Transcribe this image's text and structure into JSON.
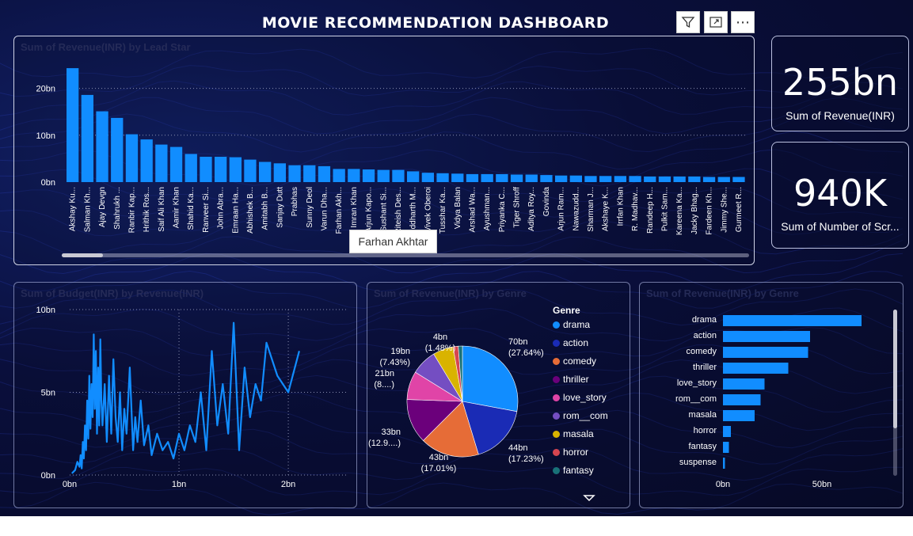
{
  "dashboard": {
    "title": "MOVIE RECOMMENDATION DASHBOARD"
  },
  "toolbar": {
    "filter_icon": "filter-icon",
    "focus_icon": "focus-mode-icon",
    "more_label": "⋯"
  },
  "tooltip": {
    "text": "Farhan Akhtar"
  },
  "cards": [
    {
      "value": "255bn",
      "label": "Sum of Revenue(INR)"
    },
    {
      "value": "940K",
      "label": "Sum of Number of Scr..."
    }
  ],
  "colors": {
    "bar": "#118dff",
    "text": "#ffffff",
    "grid": "#8a8fb0"
  },
  "chart_data": [
    {
      "type": "bar",
      "title": "Sum of Revenue(INR) by Lead Star",
      "categories": [
        "Akshay Ku...",
        "Salman Kh...",
        "Ajay Devgn",
        "Shahrukh ...",
        "Ranbir Kap...",
        "Hrithik Ros...",
        "Saif Ali Khan",
        "Aamir Khan",
        "Shahid Ka...",
        "Ranveer Si...",
        "John Abra...",
        "Emraan Ha...",
        "Abhishek B...",
        "Amitabh B...",
        "Sanjay Dutt",
        "Prabhas",
        "Sunny Deol",
        "Varun Dha...",
        "Farhan Akh...",
        "Imran Khan",
        "Arjun Kapo...",
        "Sushant Si...",
        "Riteish Des...",
        "Siddharth M...",
        "Vivek Oberoi",
        "Tusshar Ka...",
        "Vidya Balan",
        "Arshad Wa...",
        "Ayushman...",
        "Priyanka C...",
        "Tiger Shroff",
        "Aditya Roy...",
        "Govinda",
        "Arjun Ram...",
        "Nawazudd...",
        "Sharman J...",
        "Akshaye K...",
        "Irrfan Khan",
        "R. Madhav...",
        "Randeep H...",
        "Pulkit Sam...",
        "Kareena Ka...",
        "Jacky Bhag...",
        "Fardeen Kh...",
        "Jimmy She...",
        "Gurmeet R..."
      ],
      "values": [
        24.3,
        18.6,
        15.1,
        13.7,
        10.2,
        9.1,
        8.0,
        7.5,
        6.0,
        5.4,
        5.4,
        5.3,
        4.8,
        4.3,
        4.0,
        3.6,
        3.6,
        3.4,
        2.8,
        2.8,
        2.7,
        2.6,
        2.6,
        2.3,
        2.0,
        1.9,
        1.8,
        1.7,
        1.7,
        1.7,
        1.6,
        1.6,
        1.5,
        1.4,
        1.4,
        1.3,
        1.3,
        1.3,
        1.3,
        1.2,
        1.2,
        1.2,
        1.2,
        1.1,
        1.1,
        1.1
      ],
      "yticks": [
        "0bn",
        "10bn",
        "20bn"
      ],
      "ylim": [
        0,
        25
      ],
      "xlabel": "Lead Star",
      "ylabel": "Sum of Revenue(INR)",
      "grid": true
    },
    {
      "type": "line",
      "title": "Sum of Budget(INR) by Revenue(INR)",
      "x": [
        0.02,
        0.05,
        0.07,
        0.09,
        0.1,
        0.11,
        0.12,
        0.13,
        0.14,
        0.15,
        0.16,
        0.17,
        0.18,
        0.19,
        0.2,
        0.21,
        0.22,
        0.23,
        0.24,
        0.25,
        0.26,
        0.27,
        0.28,
        0.29,
        0.3,
        0.32,
        0.34,
        0.36,
        0.38,
        0.4,
        0.42,
        0.44,
        0.46,
        0.48,
        0.5,
        0.52,
        0.55,
        0.58,
        0.6,
        0.62,
        0.65,
        0.68,
        0.72,
        0.75,
        0.8,
        0.85,
        0.9,
        0.95,
        1.0,
        1.05,
        1.1,
        1.15,
        1.2,
        1.25,
        1.3,
        1.35,
        1.4,
        1.45,
        1.5,
        1.55,
        1.6,
        1.65,
        1.7,
        1.75,
        1.8,
        1.9,
        2.0,
        2.1
      ],
      "y": [
        0.1,
        0.3,
        0.8,
        0.5,
        1.2,
        0.4,
        2.0,
        1.0,
        3.0,
        1.5,
        4.5,
        2.2,
        6.0,
        2.8,
        5.5,
        3.5,
        8.5,
        4.0,
        7.5,
        2.5,
        6.5,
        3.0,
        8.2,
        4.5,
        3.0,
        5.5,
        2.0,
        6.0,
        2.5,
        7.0,
        3.5,
        2.0,
        5.0,
        1.5,
        4.0,
        2.5,
        6.5,
        1.5,
        3.5,
        2.0,
        4.5,
        1.8,
        3.0,
        1.2,
        2.5,
        1.5,
        2.0,
        1.0,
        2.5,
        1.5,
        3.0,
        2.0,
        5.0,
        1.5,
        7.5,
        3.0,
        5.5,
        2.5,
        9.2,
        1.5,
        6.5,
        3.5,
        5.5,
        4.5,
        8.0,
        6.0,
        5.0,
        7.5
      ],
      "xticks": [
        "0bn",
        "1bn",
        "2bn"
      ],
      "yticks": [
        "0bn",
        "5bn",
        "10bn"
      ],
      "ylim": [
        0,
        10
      ],
      "xlabel": "Revenue(INR)",
      "ylabel": "Sum of Budget(INR)",
      "grid": true
    },
    {
      "type": "pie",
      "title": "Sum of Revenue(INR) by Genre",
      "legend_title": "Genre",
      "slices": [
        {
          "name": "drama",
          "value": 27.64,
          "color": "#118dff"
        },
        {
          "name": "action",
          "value": 17.23,
          "color": "#1a2bb5"
        },
        {
          "name": "comedy",
          "value": 17.01,
          "color": "#e66c37"
        },
        {
          "name": "thriller",
          "value": 12.9,
          "color": "#6b007b"
        },
        {
          "name": "love_story",
          "value": 8.2,
          "color": "#e044a7"
        },
        {
          "name": "rom__com",
          "value": 7.43,
          "color": "#744ec2"
        },
        {
          "name": "masala",
          "value": 5.9,
          "color": "#d9b300"
        },
        {
          "name": "horror",
          "value": 1.48,
          "color": "#d64550"
        },
        {
          "name": "fantasy",
          "value": 1.2,
          "color": "#197278"
        }
      ],
      "labels": [
        {
          "line1": "70bn",
          "line2": "(27.64%)"
        },
        {
          "line1": "44bn",
          "line2": "(17.23%)"
        },
        {
          "line1": "43bn",
          "line2": "(17.01%)"
        },
        {
          "line1": "33bn",
          "line2": "(12.9....)"
        },
        {
          "line1": "21bn",
          "line2": "(8....)"
        },
        {
          "line1": "19bn",
          "line2": "(7.43%)"
        },
        {
          "line1": "4bn",
          "line2": "(1.48%)"
        }
      ]
    },
    {
      "type": "bar",
      "orientation": "horizontal",
      "title": "Sum of Revenue(INR) by Genre",
      "categories": [
        "drama",
        "action",
        "comedy",
        "thriller",
        "love_story",
        "rom__com",
        "masala",
        "horror",
        "fantasy",
        "suspense"
      ],
      "values": [
        70,
        44,
        43,
        33,
        21,
        19,
        16,
        4,
        3,
        1
      ],
      "xticks": [
        "0bn",
        "50bn"
      ],
      "xlim": [
        0,
        80
      ],
      "xlabel": "Sum of Revenue(INR)",
      "ylabel": "Genre"
    }
  ]
}
